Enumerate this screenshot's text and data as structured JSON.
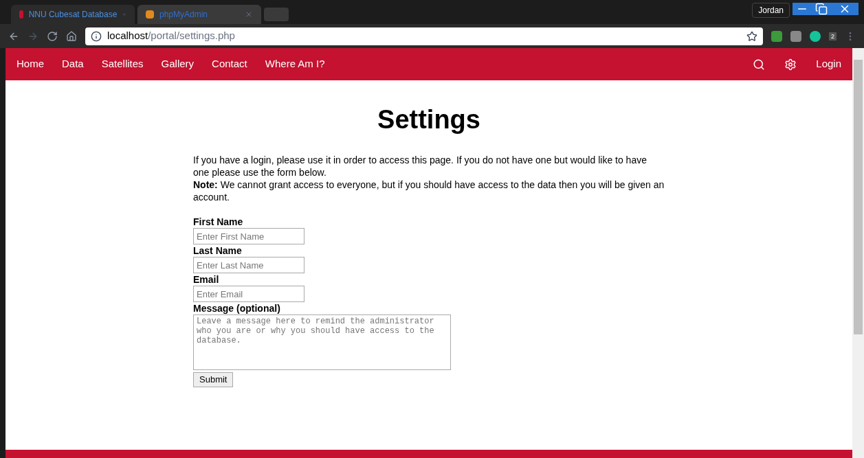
{
  "browser": {
    "tabs": [
      {
        "title": "NNU Cubesat Database",
        "selected": true
      },
      {
        "title": "phpMyAdmin",
        "selected": false
      }
    ],
    "profile": "Jordan",
    "url_host": "localhost",
    "url_path": "/portal/settings.php",
    "extension_badge": "2"
  },
  "nav": {
    "items": [
      "Home",
      "Data",
      "Satellites",
      "Gallery",
      "Contact",
      "Where Am I?"
    ],
    "login": "Login"
  },
  "page": {
    "title": "Settings",
    "intro": "If you have a login, please use it in order to access this page. If you do not have one but would like to have one please use the form below.",
    "note": "**Note:** We cannot grant access to everyone, but if you should have access to the data then you will be given an account."
  },
  "form": {
    "fields": [
      {
        "kind": "input",
        "label": "First Name",
        "placeholder": "Enter First Name"
      },
      {
        "kind": "input",
        "label": "Last Name",
        "placeholder": "Enter Last Name"
      },
      {
        "kind": "input",
        "label": "Email",
        "placeholder": "Enter Email"
      },
      {
        "kind": "textarea",
        "label": "Message (optional)",
        "placeholder": "Leave a message here to remind the administrator who you are or why you should have access to the database."
      }
    ],
    "submit": "Submit"
  }
}
